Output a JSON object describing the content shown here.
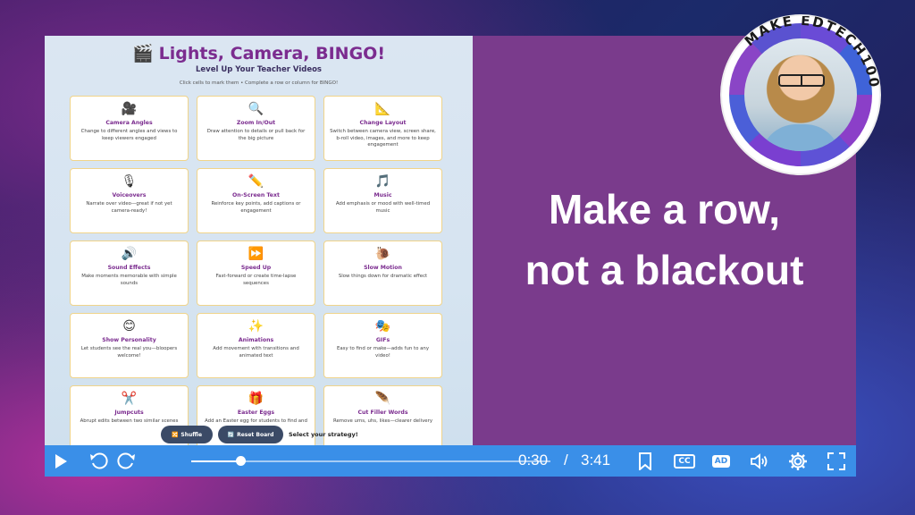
{
  "bingo": {
    "title": "Lights, Camera, BINGO!",
    "subtitle": "Level Up Your Teacher Videos",
    "help": "Click cells to mark them • Complete a row or column for BINGO!",
    "cells": [
      {
        "icon": "🎥",
        "title": "Camera Angles",
        "desc": "Change to different angles and views to keep viewers engaged"
      },
      {
        "icon": "🔍",
        "title": "Zoom In/Out",
        "desc": "Draw attention to details or pull back for the big picture"
      },
      {
        "icon": "📐",
        "title": "Change Layout",
        "desc": "Switch between camera view, screen share, b-roll video, images, and more to keep engagement"
      },
      {
        "icon": "🎙",
        "title": "Voiceovers",
        "desc": "Narrate over video—great if not yet camera-ready!"
      },
      {
        "icon": "✏️",
        "title": "On-Screen Text",
        "desc": "Reinforce key points, add captions or engagement"
      },
      {
        "icon": "🎵",
        "title": "Music",
        "desc": "Add emphasis or mood with well-timed music"
      },
      {
        "icon": "🔊",
        "title": "Sound Effects",
        "desc": "Make moments memorable with simple sounds"
      },
      {
        "icon": "⏩",
        "title": "Speed Up",
        "desc": "Fast-forward or create time-lapse sequences"
      },
      {
        "icon": "🐌",
        "title": "Slow Motion",
        "desc": "Slow things down for dramatic effect"
      },
      {
        "icon": "😊",
        "title": "Show Personality",
        "desc": "Let students see the real you—bloopers welcome!"
      },
      {
        "icon": "✨",
        "title": "Animations",
        "desc": "Add movement with transitions and animated text"
      },
      {
        "icon": "🎭",
        "title": "GIFs",
        "desc": "Easy to find or make—adds fun to any video!"
      },
      {
        "icon": "✂️",
        "title": "Jumpcuts",
        "desc": "Abrupt edits between two similar scenes"
      },
      {
        "icon": "🎁",
        "title": "Easter Eggs",
        "desc": "Add an Easter egg for students to find and discover"
      },
      {
        "icon": "🪶",
        "title": "Cut Filler Words",
        "desc": "Remove ums, uhs, likes—clearer delivery"
      }
    ],
    "shuffle_label": "Shuffle",
    "reset_label": "Reset Board",
    "strategy_label": "Select your strategy!"
  },
  "caption": {
    "line1": "Make a row,",
    "line2": "not a blackout"
  },
  "badge": {
    "ring_text": "MAKE EDTECH100"
  },
  "player": {
    "current_time": "0:30",
    "separator": "/",
    "duration": "3:41",
    "progress_fraction": 0.136,
    "cc_label": "CC",
    "ad_label": "AD",
    "icons": [
      "play-icon",
      "rewind-icon",
      "forward-icon",
      "bookmark-icon",
      "cc-icon",
      "ad-icon",
      "volume-icon",
      "settings-icon",
      "fullscreen-icon"
    ]
  },
  "colors": {
    "accent": "#3a8fe8",
    "panel_purple": "#7a3b8c",
    "title_purple": "#7b2c8f"
  }
}
